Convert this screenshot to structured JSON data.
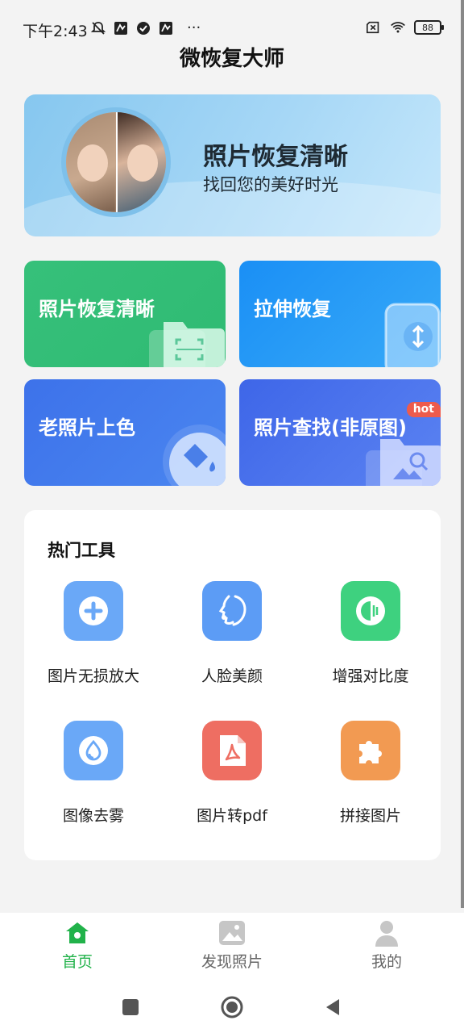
{
  "status_bar": {
    "time": "下午2:43",
    "more": "···",
    "battery": "88"
  },
  "app_title": "微恢复大师",
  "banner": {
    "title": "照片恢复清晰",
    "subtitle": "找回您的美好时光"
  },
  "features": [
    {
      "label": "照片恢复清晰",
      "color": "#34bf78"
    },
    {
      "label": "拉伸恢复",
      "color": "#2a9cf7"
    },
    {
      "label": "老照片上色",
      "color": "#437cec"
    },
    {
      "label": "照片查找(非原图)",
      "color": "#4b74ee",
      "badge": "hot"
    }
  ],
  "tools": {
    "title": "热门工具",
    "items": [
      {
        "label": "图片无损放大",
        "icon": "plus-circle-icon",
        "color": "#6aa8f7"
      },
      {
        "label": "人脸美颜",
        "icon": "face-profile-icon",
        "color": "#5c9cf5"
      },
      {
        "label": "增强对比度",
        "icon": "contrast-icon",
        "color": "#3ed17f"
      },
      {
        "label": "图像去雾",
        "icon": "droplet-icon",
        "color": "#6aa8f7"
      },
      {
        "label": "图片转pdf",
        "icon": "pdf-icon",
        "color": "#ee6e62"
      },
      {
        "label": "拼接图片",
        "icon": "puzzle-icon",
        "color": "#f29a52"
      }
    ]
  },
  "bottom_nav": [
    {
      "label": "首页",
      "icon": "home-icon",
      "active": true
    },
    {
      "label": "发现照片",
      "icon": "photo-icon",
      "active": false
    },
    {
      "label": "我的",
      "icon": "user-icon",
      "active": false
    }
  ]
}
